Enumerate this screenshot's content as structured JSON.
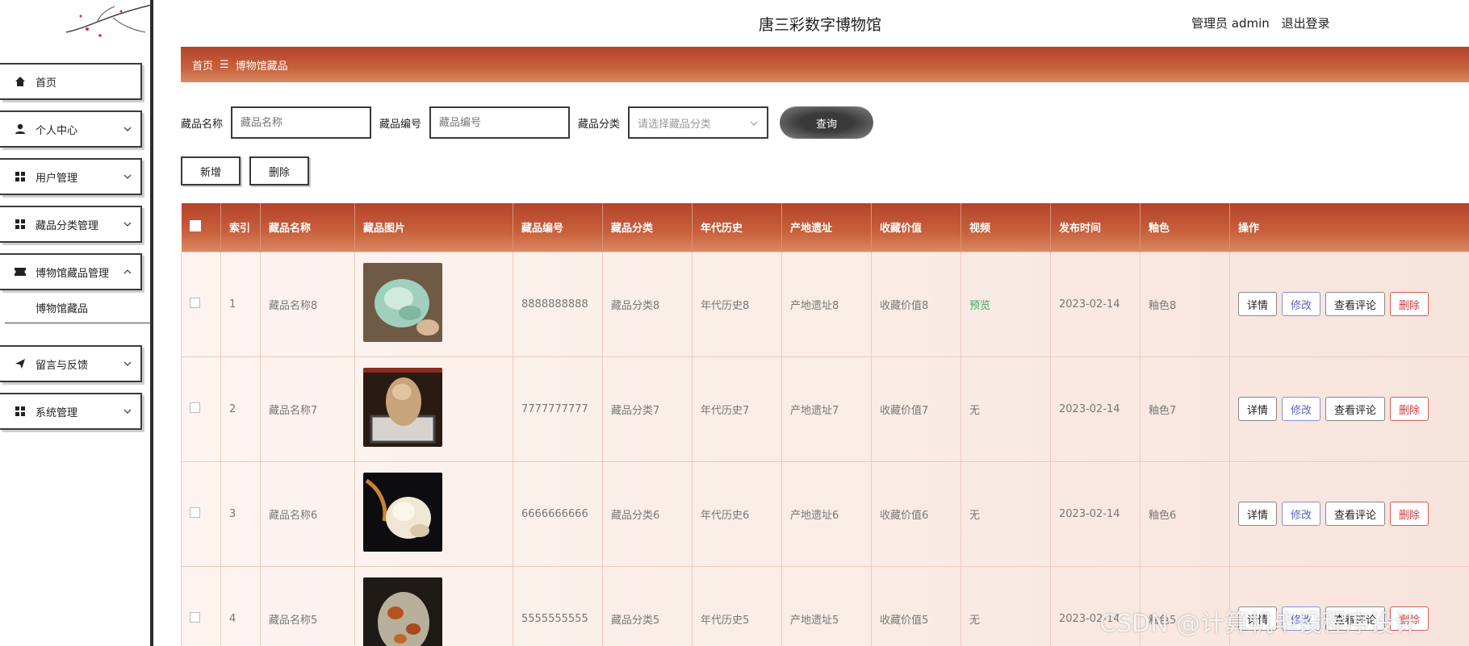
{
  "header": {
    "site_title": "唐三彩数字博物馆",
    "user_label": "管理员 admin",
    "logout_label": "退出登录"
  },
  "sidebar": {
    "items": [
      {
        "label": "首页",
        "icon": "home-icon"
      },
      {
        "label": "个人中心",
        "icon": "user-icon"
      },
      {
        "label": "用户管理",
        "icon": "grid-icon"
      },
      {
        "label": "藏品分类管理",
        "icon": "grid-icon"
      },
      {
        "label": "博物馆藏品管理",
        "icon": "ticket-icon"
      },
      {
        "label": "留言与反馈",
        "icon": "send-icon"
      },
      {
        "label": "系统管理",
        "icon": "grid-icon"
      }
    ],
    "subitem": "博物馆藏品"
  },
  "breadcrumb": {
    "home": "首页",
    "separator": "☰",
    "current": "博物馆藏品"
  },
  "search": {
    "name_label": "藏品名称",
    "name_placeholder": "藏品名称",
    "code_label": "藏品编号",
    "code_placeholder": "藏品编号",
    "category_label": "藏品分类",
    "category_placeholder": "请选择藏品分类",
    "query_label": "查询"
  },
  "actions": {
    "add_label": "新增",
    "delete_label": "删除"
  },
  "table": {
    "headers": [
      "索引",
      "藏品名称",
      "藏品图片",
      "藏品编号",
      "藏品分类",
      "年代历史",
      "产地遗址",
      "收藏价值",
      "视频",
      "发布时间",
      "釉色",
      "操作"
    ],
    "rows": [
      {
        "index": "1",
        "name": "藏品名称8",
        "code": "8888888888",
        "category": "藏品分类8",
        "era": "年代历史8",
        "origin": "产地遗址8",
        "value": "收藏价值8",
        "video": "预览",
        "date": "2023-02-14",
        "glaze": "釉色8"
      },
      {
        "index": "2",
        "name": "藏品名称7",
        "code": "7777777777",
        "category": "藏品分类7",
        "era": "年代历史7",
        "origin": "产地遗址7",
        "value": "收藏价值7",
        "video": "无",
        "date": "2023-02-14",
        "glaze": "釉色7"
      },
      {
        "index": "3",
        "name": "藏品名称6",
        "code": "6666666666",
        "category": "藏品分类6",
        "era": "年代历史6",
        "origin": "产地遗址6",
        "value": "收藏价值6",
        "video": "无",
        "date": "2023-02-14",
        "glaze": "釉色6"
      },
      {
        "index": "4",
        "name": "藏品名称5",
        "code": "5555555555",
        "category": "藏品分类5",
        "era": "年代历史5",
        "origin": "产地遗址5",
        "value": "收藏价值5",
        "video": "无",
        "date": "2023-02-14",
        "glaze": "釉色5"
      }
    ],
    "ops": {
      "detail": "详情",
      "edit": "修改",
      "comments": "查看评论",
      "delete": "删除"
    }
  },
  "watermark": "CSDN @计算机毕设程序设计",
  "colors": {
    "accent": "#c0502f",
    "edit": "#5a63c4",
    "delete": "#d23c3c",
    "preview": "#3caa5e"
  }
}
